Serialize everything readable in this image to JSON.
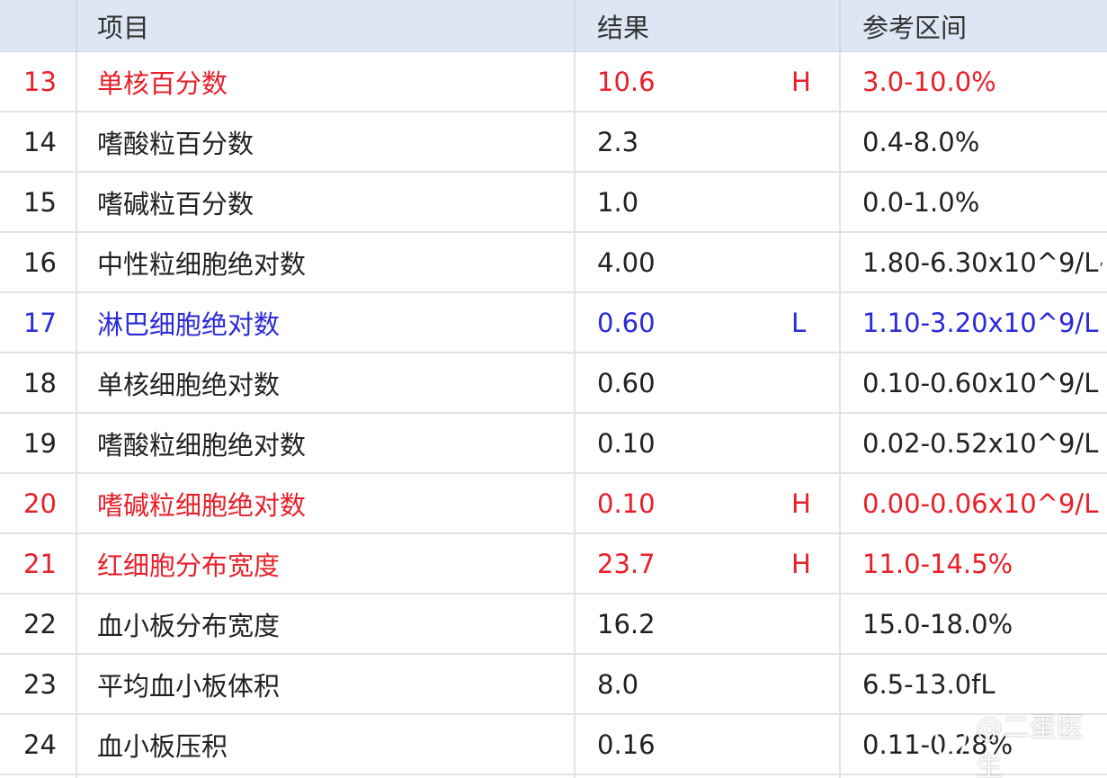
{
  "table": {
    "header": {
      "item": "项目",
      "result": "结果",
      "reference": "参考区间"
    },
    "rows": [
      {
        "num": "13",
        "name": "单核百分数",
        "result": "10.6",
        "flag": "H",
        "reference": "3.0-10.0%",
        "status": "high"
      },
      {
        "num": "14",
        "name": "嗜酸粒百分数",
        "result": "2.3",
        "flag": "",
        "reference": "0.4-8.0%",
        "status": "normal"
      },
      {
        "num": "15",
        "name": "嗜碱粒百分数",
        "result": "1.0",
        "flag": "",
        "reference": "0.0-1.0%",
        "status": "normal"
      },
      {
        "num": "16",
        "name": "中性粒细胞绝对数",
        "result": "4.00",
        "flag": "",
        "reference": "1.80-6.30x10^9/L",
        "status": "normal"
      },
      {
        "num": "17",
        "name": "淋巴细胞绝对数",
        "result": "0.60",
        "flag": "L",
        "reference": "1.10-3.20x10^9/L",
        "status": "low"
      },
      {
        "num": "18",
        "name": "单核细胞绝对数",
        "result": "0.60",
        "flag": "",
        "reference": "0.10-0.60x10^9/L",
        "status": "normal"
      },
      {
        "num": "19",
        "name": "嗜酸粒细胞绝对数",
        "result": "0.10",
        "flag": "",
        "reference": "0.02-0.52x10^9/L",
        "status": "normal"
      },
      {
        "num": "20",
        "name": "嗜碱粒细胞绝对数",
        "result": "0.10",
        "flag": "H",
        "reference": "0.00-0.06x10^9/L",
        "status": "high"
      },
      {
        "num": "21",
        "name": "红细胞分布宽度",
        "result": "23.7",
        "flag": "H",
        "reference": "11.0-14.5%",
        "status": "high"
      },
      {
        "num": "22",
        "name": "血小板分布宽度",
        "result": "16.2",
        "flag": "",
        "reference": "15.0-18.0%",
        "status": "normal"
      },
      {
        "num": "23",
        "name": "平均血小板体积",
        "result": "8.0",
        "flag": "",
        "reference": "6.5-13.0fL",
        "status": "normal"
      },
      {
        "num": "24",
        "name": "血小板压积",
        "result": "0.16",
        "flag": "",
        "reference": "0.11-0.28%",
        "status": "normal"
      }
    ]
  },
  "colors": {
    "high": "#e8202a",
    "low": "#2a2ad8",
    "normal": "#222222",
    "header_bg": "#dde6f4"
  },
  "watermark": {
    "icon": "tooth-icon",
    "text": "@二蛋医生"
  }
}
